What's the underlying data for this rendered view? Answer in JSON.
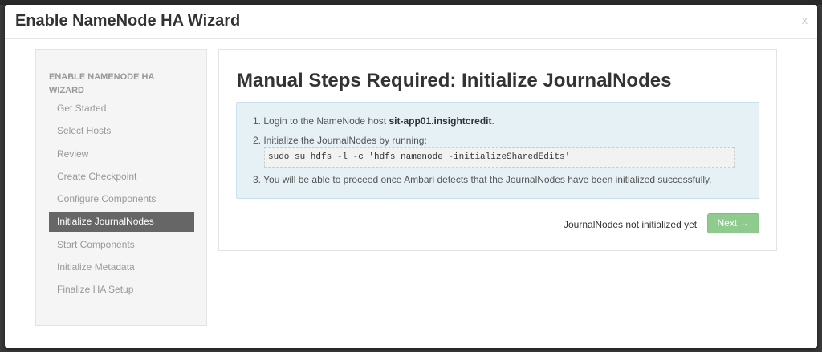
{
  "modal": {
    "title": "Enable NameNode HA Wizard",
    "close_label": "x"
  },
  "sidebar": {
    "header": "ENABLE NAMENODE HA WIZARD",
    "items": [
      {
        "label": "Get Started",
        "active": false
      },
      {
        "label": "Select Hosts",
        "active": false
      },
      {
        "label": "Review",
        "active": false
      },
      {
        "label": "Create Checkpoint",
        "active": false
      },
      {
        "label": "Configure Components",
        "active": false
      },
      {
        "label": "Initialize JournalNodes",
        "active": true
      },
      {
        "label": "Start Components",
        "active": false
      },
      {
        "label": "Initialize Metadata",
        "active": false
      },
      {
        "label": "Finalize HA Setup",
        "active": false
      }
    ]
  },
  "content": {
    "title": "Manual Steps Required: Initialize JournalNodes",
    "steps": {
      "s1_prefix": "1. Login to the NameNode host ",
      "s1_host": "sit-app01.insightcredit",
      "s1_suffix": ".",
      "s2": "2. Initialize the JournalNodes by running:",
      "command": "sudo su hdfs -l -c 'hdfs namenode -initializeSharedEdits'",
      "s3": "3. You will be able to proceed once Ambari detects that the JournalNodes have been initialized successfully."
    },
    "status": "JournalNodes not initialized yet",
    "next_label": "Next →"
  },
  "colors": {
    "active_item_bg": "#666666",
    "info_bg": "#e6f1f6",
    "next_button_bg": "#8fcb8f"
  }
}
